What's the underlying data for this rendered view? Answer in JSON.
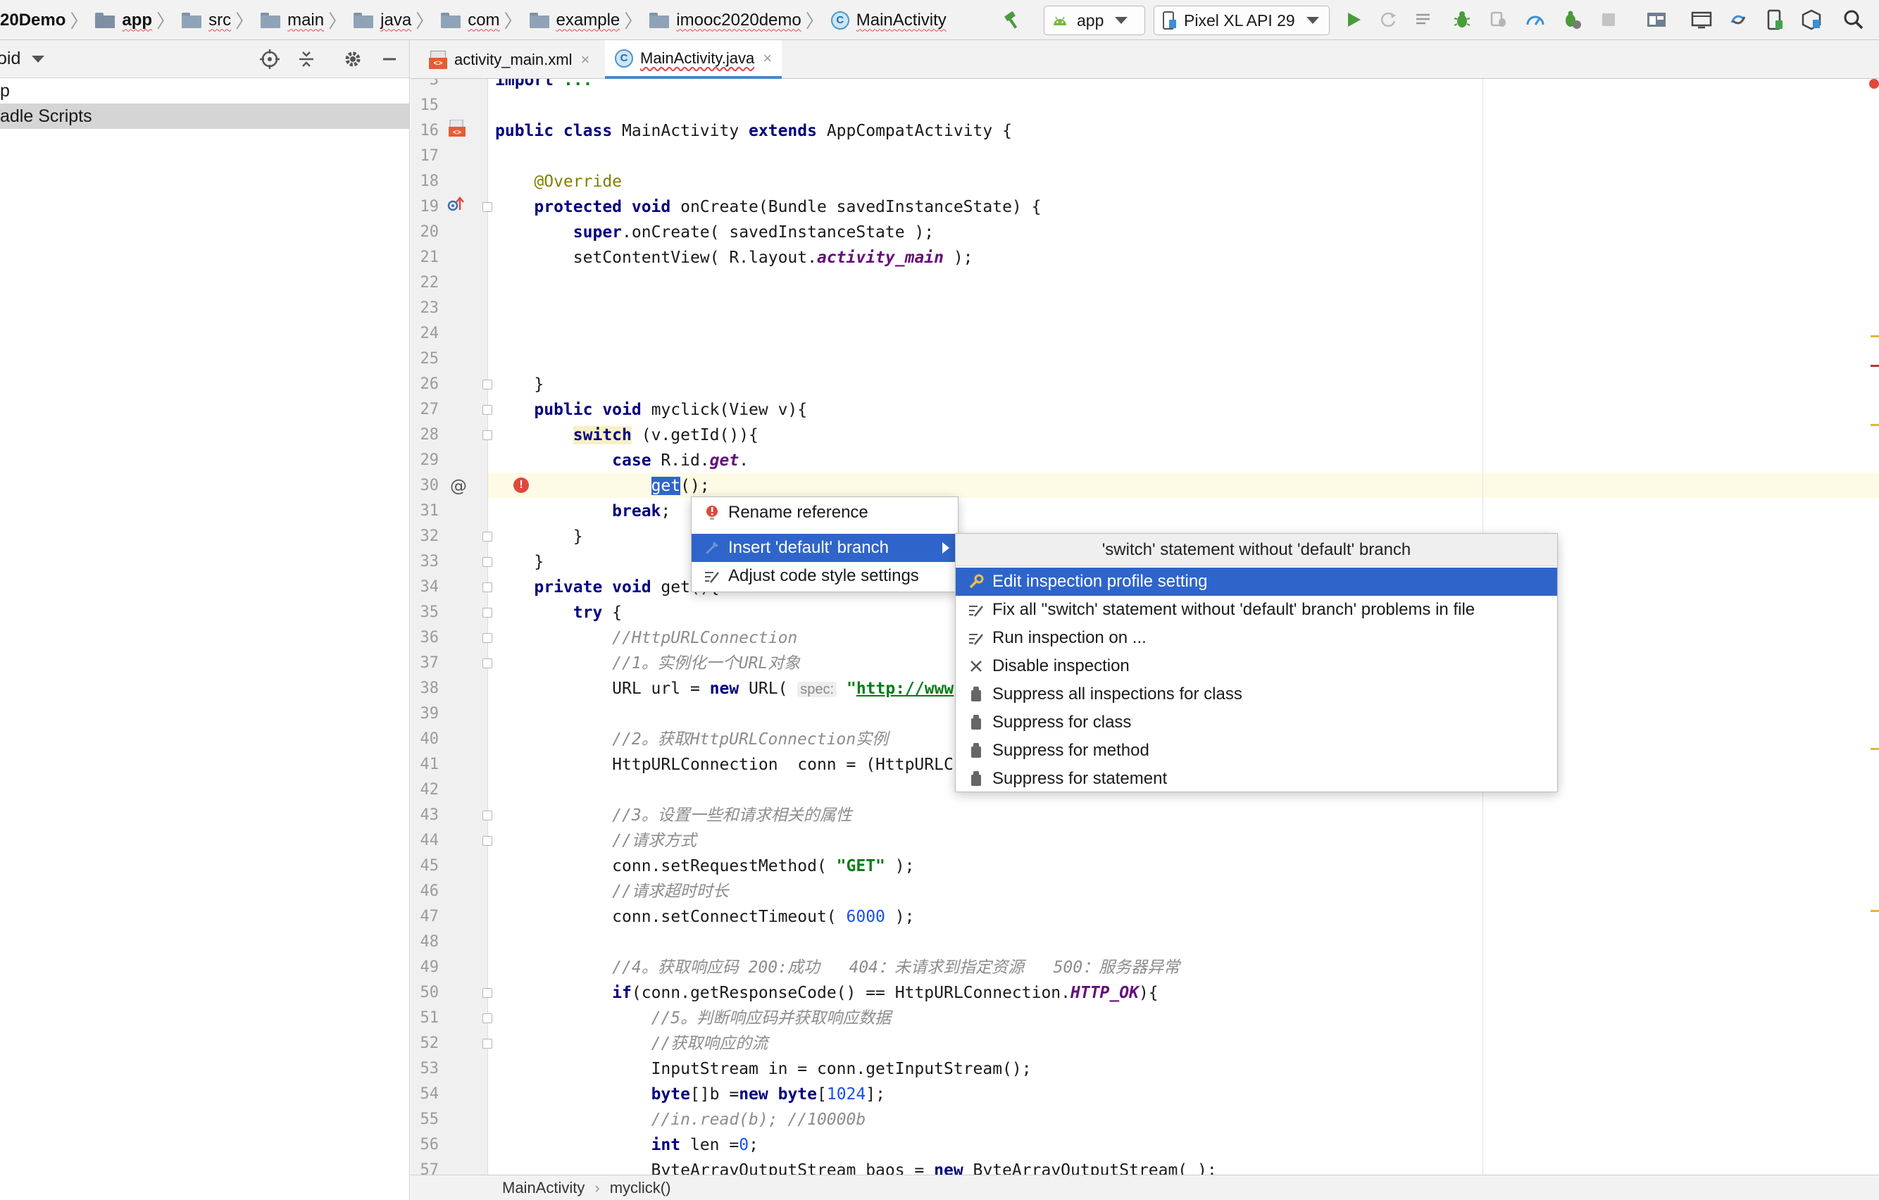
{
  "breadcrumb": {
    "project": "20Demo",
    "items": [
      "app",
      "src",
      "main",
      "java",
      "com",
      "example",
      "imooc2020demo",
      "MainActivity"
    ]
  },
  "toolbar": {
    "run_config": "app",
    "device": "Pixel XL API 29"
  },
  "project_panel": {
    "view_label": "oid",
    "items": [
      "p",
      "adle Scripts"
    ]
  },
  "editor_tabs": [
    {
      "label": "activity_main.xml",
      "active": false
    },
    {
      "label": "MainActivity.java",
      "active": true
    }
  ],
  "code": {
    "lines": [
      {
        "n": "3",
        "html": "<span class=\"kw\">import</span> <span class=\"str\">...</span>"
      },
      {
        "n": "15",
        "html": ""
      },
      {
        "n": "16",
        "html": "<span class=\"kw\">public class</span> MainActivity <span class=\"kw\">extends</span> AppCompatActivity {"
      },
      {
        "n": "17",
        "html": ""
      },
      {
        "n": "18",
        "html": "    <span class=\"ann\">@Override</span>"
      },
      {
        "n": "19",
        "html": "    <span class=\"kw\">protected void</span> onCreate(Bundle savedInstanceState) {"
      },
      {
        "n": "20",
        "html": "        <span class=\"kw\">super</span>.onCreate( savedInstanceState );"
      },
      {
        "n": "21",
        "html": "        setContentView( R.layout.<span class=\"fld\">activity_main</span> );"
      },
      {
        "n": "22",
        "html": ""
      },
      {
        "n": "23",
        "html": ""
      },
      {
        "n": "24",
        "html": ""
      },
      {
        "n": "25",
        "html": ""
      },
      {
        "n": "26",
        "html": "    }"
      },
      {
        "n": "27",
        "html": "    <span class=\"kw\">public void</span> myclick(View v){"
      },
      {
        "n": "28",
        "html": "        <span class=\"kw hl-switch\">switch</span> (v.getId()){"
      },
      {
        "n": "29",
        "html": "            <span class=\"kw\">case</span> R.id.<span class=\"fld\">get</span>."
      },
      {
        "n": "30",
        "html": "                <span class=\"sel-word\">get</span>();"
      },
      {
        "n": "31",
        "html": "            <span class=\"kw\">break</span>;"
      },
      {
        "n": "32",
        "html": "        }"
      },
      {
        "n": "33",
        "html": "    }"
      },
      {
        "n": "34",
        "html": "    <span class=\"kw\">private void</span> get(){"
      },
      {
        "n": "35",
        "html": "        <span class=\"kw\">try</span> {"
      },
      {
        "n": "36",
        "html": "            <span class=\"cm\">//HttpURLConnection</span>"
      },
      {
        "n": "37",
        "html": "            <span class=\"cm\">//1。实例化一个URL对象</span>"
      },
      {
        "n": "38",
        "html": "            URL url = <span class=\"kw\">new</span> URL( <span class=\"hint\">spec:</span> <span class=\"str\">\"</span><span class=\"url\">http://www</span>"
      },
      {
        "n": "39",
        "html": ""
      },
      {
        "n": "40",
        "html": "            <span class=\"cm\">//2。获取HttpURLConnection实例</span>"
      },
      {
        "n": "41",
        "html": "            HttpURLConnection  conn = (HttpURLC"
      },
      {
        "n": "42",
        "html": ""
      },
      {
        "n": "43",
        "html": "            <span class=\"cm\">//3。设置一些和请求相关的属性</span>"
      },
      {
        "n": "44",
        "html": "            <span class=\"cm\">//请求方式</span>"
      },
      {
        "n": "45",
        "html": "            conn.setRequestMethod( <span class=\"str\">\"GET\"</span> );"
      },
      {
        "n": "46",
        "html": "            <span class=\"cm\">//请求超时时长</span>"
      },
      {
        "n": "47",
        "html": "            conn.setConnectTimeout( <span class=\"num-lit\">6000</span> );"
      },
      {
        "n": "48",
        "html": ""
      },
      {
        "n": "49",
        "html": "            <span class=\"cm\">//4。获取响应码 200:成功   404：未请求到指定资源   500：服务器异常</span>"
      },
      {
        "n": "50",
        "html": "            <span class=\"kw\">if</span>(conn.getResponseCode() == HttpURLConnection.<span class=\"fld\">HTTP_OK</span>){"
      },
      {
        "n": "51",
        "html": "                <span class=\"cm\">//5。判断响应码并获取响应数据</span>"
      },
      {
        "n": "52",
        "html": "                <span class=\"cm\">//获取响应的流</span>"
      },
      {
        "n": "53",
        "html": "                InputStream in = conn.getInputStream();"
      },
      {
        "n": "54",
        "html": "                <span class=\"kw\">byte</span>[]b =<span class=\"kw\">new byte</span>[<span class=\"num-lit\">1024</span>];"
      },
      {
        "n": "55",
        "html": "                <span class=\"cm\">//in.read(b); //10000b</span>"
      },
      {
        "n": "56",
        "html": "                <span class=\"kw\">int</span> len =<span class=\"num-lit\">0</span>;"
      },
      {
        "n": "57",
        "html": "                ByteArrayOutputStream baos = <span class=\"kw\">new</span> ByteArrayOutputStream( );"
      }
    ]
  },
  "intention_menu": {
    "items": [
      {
        "label": "Rename reference",
        "icon": "error-bulb-icon"
      },
      {
        "label": "Insert 'default' branch",
        "icon": "quickfix-icon",
        "active": true
      },
      {
        "label": "Adjust code style settings",
        "icon": "edit-icon"
      }
    ]
  },
  "submenu": {
    "header": "'switch' statement without 'default' branch",
    "items": [
      {
        "label": "Edit inspection profile setting",
        "icon": "wrench-icon",
        "active": true
      },
      {
        "label": "Fix all ''switch' statement without 'default' branch' problems in file",
        "icon": "edit-icon"
      },
      {
        "label": "Run inspection on ...",
        "icon": "edit-icon"
      },
      {
        "label": "Disable inspection",
        "icon": "close-icon"
      },
      {
        "label": "Suppress all inspections for class",
        "icon": "suppress-icon"
      },
      {
        "label": "Suppress for class",
        "icon": "suppress-icon"
      },
      {
        "label": "Suppress for method",
        "icon": "suppress-icon"
      },
      {
        "label": "Suppress for statement",
        "icon": "suppress-icon"
      }
    ]
  },
  "status_breadcrumb": [
    "MainActivity",
    "myclick()"
  ],
  "colors": {
    "selection": "#2f65ca",
    "keyword": "#000080",
    "error": "#e0483d"
  }
}
